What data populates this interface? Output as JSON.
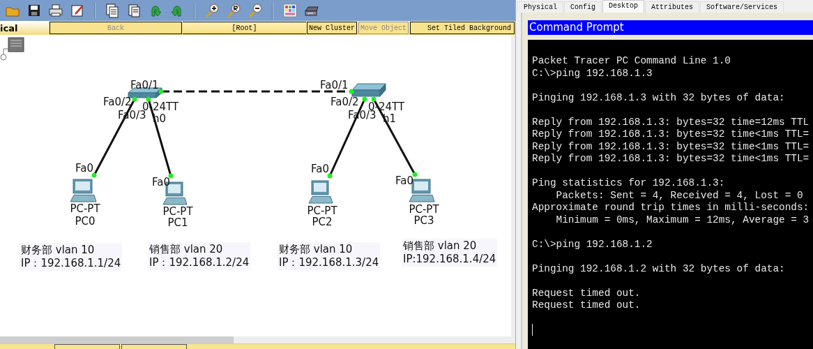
{
  "workspace_bar": {
    "tab_label": "ical",
    "buttons": [
      {
        "label": "Back",
        "disabled": true
      },
      {
        "label": "New Cluster",
        "disabled": false
      },
      {
        "label": "Move Object",
        "disabled": true
      },
      {
        "label": "Set Tiled Background",
        "disabled": false
      }
    ],
    "path_label": "[Root]"
  },
  "topology": {
    "devices": [
      {
        "kind": "switch",
        "labels": [
          "0-24TT",
          "h0"
        ]
      },
      {
        "kind": "switch",
        "labels": [
          "0-24TT",
          "h1"
        ]
      },
      {
        "kind": "pc",
        "labels": [
          "PC-PT",
          "PC0"
        ]
      },
      {
        "kind": "pc",
        "labels": [
          "PC-PT",
          "PC1"
        ]
      },
      {
        "kind": "pc",
        "labels": [
          "PC-PT",
          "PC2"
        ]
      },
      {
        "kind": "pc",
        "labels": [
          "PC-PT",
          "PC3"
        ]
      }
    ],
    "links": [
      {
        "kind": "crossover",
        "end_labels": [
          "Fa0/1",
          "Fa0/1"
        ]
      },
      {
        "kind": "straight",
        "end_labels": [
          "Fa0/2",
          "Fa0"
        ]
      },
      {
        "kind": "straight",
        "end_labels": [
          "Fa0/3",
          "Fa0"
        ]
      },
      {
        "kind": "straight",
        "end_labels": [
          "Fa0/2",
          "Fa0"
        ]
      },
      {
        "kind": "straight",
        "end_labels": [
          "Fa0/3",
          "Fa0"
        ]
      }
    ],
    "notes": [
      {
        "lines": [
          "财务部 vlan 10",
          "IP：192.168.1.1/24"
        ]
      },
      {
        "lines": [
          "销售部 vlan 20",
          "IP：192.168.1.2/24"
        ]
      },
      {
        "lines": [
          "财务部 vlan 10",
          "IP：192.168.1.3/24"
        ]
      },
      {
        "lines": [
          "销售部 vlan 20",
          "IP:192.168.1.4/24"
        ]
      }
    ]
  },
  "device_tabs": [
    {
      "label": "Physical",
      "selected": false
    },
    {
      "label": "Config",
      "selected": false
    },
    {
      "label": "Desktop",
      "selected": true
    },
    {
      "label": "Attributes",
      "selected": false
    },
    {
      "label": "Software/Services",
      "selected": false
    }
  ],
  "command_prompt": {
    "title": "Command Prompt",
    "cursor_visible": true,
    "blocks": [
      [
        "Packet Tracer PC Command Line 1.0",
        "C:\\>ping 192.168.1.3"
      ],
      [
        "Pinging 192.168.1.3 with 32 bytes of data:"
      ],
      [
        "Reply from 192.168.1.3: bytes=32 time=12ms TTL",
        "Reply from 192.168.1.3: bytes=32 time<1ms TTL=",
        "Reply from 192.168.1.3: bytes=32 time<1ms TTL=",
        "Reply from 192.168.1.3: bytes=32 time<1ms TTL="
      ],
      [
        "Ping statistics for 192.168.1.3:",
        "    Packets: Sent = 4, Received = 4, Lost = 0",
        "Approximate round trip times in milli-seconds:",
        "    Minimum = 0ms, Maximum = 12ms, Average = 3"
      ],
      [
        "C:\\>ping 192.168.1.2"
      ],
      [
        "Pinging 192.168.1.2 with 32 bytes of data:"
      ],
      [
        "Request timed out.",
        "Request timed out."
      ]
    ]
  }
}
